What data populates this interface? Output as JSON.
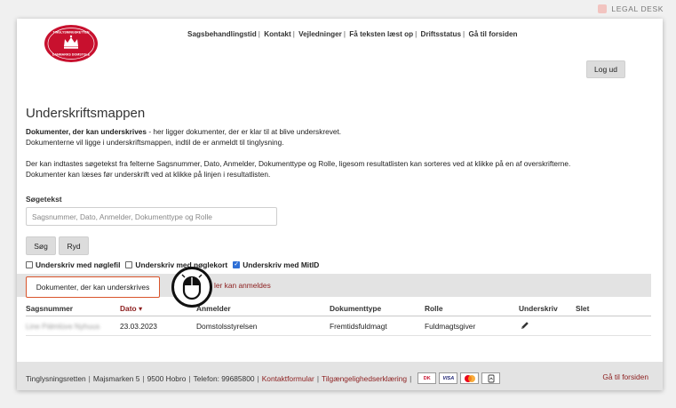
{
  "brand": {
    "label": "LEGAL DESK"
  },
  "logo": {
    "top_text": "TINGLYSNINGSRETTEN",
    "bottom_text": "DANMARKS DOMSTOLE"
  },
  "nav": {
    "items": [
      "Sagsbehandlingstid",
      "Kontakt",
      "Vejledninger",
      "Få teksten læst op",
      "Driftsstatus",
      "Gå til forsiden"
    ]
  },
  "logout_label": "Log ud",
  "page_title": "Underskriftsmappen",
  "intro": {
    "bold_lead": "Dokumenter, der kan underskrives",
    "line1_rest": " - her ligger dokumenter, der er klar til at blive underskrevet.",
    "line2": "Dokumenterne vil ligge i underskriftsmappen, indtil de er anmeldt til tinglysning.",
    "line3": "Der kan indtastes søgetekst fra felterne Sagsnummer, Dato, Anmelder, Dokumenttype og Rolle, ligesom resultatlisten kan sorteres ved at klikke på en af overskrifterne.",
    "line4": "Dokumenter kan læses før underskrift ved at klikke på linjen i resultatlisten."
  },
  "search": {
    "label": "Søgetekst",
    "placeholder": "Sagsnummer, Dato, Anmelder, Dokumenttype og Rolle",
    "value": "",
    "search_button": "Søg",
    "clear_button": "Ryd"
  },
  "sign_options": [
    {
      "label": "Underskriv med nøglefil",
      "checked": false
    },
    {
      "label": "Underskriv med nøglekort",
      "checked": false
    },
    {
      "label": "Underskriv med MitID",
      "checked": true
    }
  ],
  "tabs": {
    "active": "Dokumenter, der kan underskrives",
    "other": "ler kan anmeldes"
  },
  "table": {
    "headers": [
      "Sagsnummer",
      "Dato",
      "Anmelder",
      "Dokumenttype",
      "Rolle",
      "Underskriv",
      "Slet"
    ],
    "sorted_column": "Dato",
    "sort_indicator": "▾",
    "rows": [
      {
        "sagsnummer": "Line Pálmlüve Nyhuus",
        "dato": "23.03.2023",
        "anmelder": "Domstolsstyrelsen",
        "dokumenttype": "Fremtidsfuldmagt",
        "rolle": "Fuldmagtsgiver",
        "underskriv_icon": "pencil-icon"
      }
    ]
  },
  "footer": {
    "org": "Tinglysningsretten",
    "address": "Majsmarken 5",
    "city": "9500 Hobro",
    "phone": "Telefon: 99685800",
    "contact_link": "Kontaktformular",
    "accessibility_link": "Tilgængelighedserklæring",
    "cards": [
      "DK",
      "VISA",
      "MC",
      "MobilePay"
    ],
    "home_link": "Gå til forsiden"
  },
  "colors": {
    "accent_red": "#8b1c1c",
    "highlight_orange": "#d9542b",
    "checkbox_blue": "#2e6fd6"
  }
}
